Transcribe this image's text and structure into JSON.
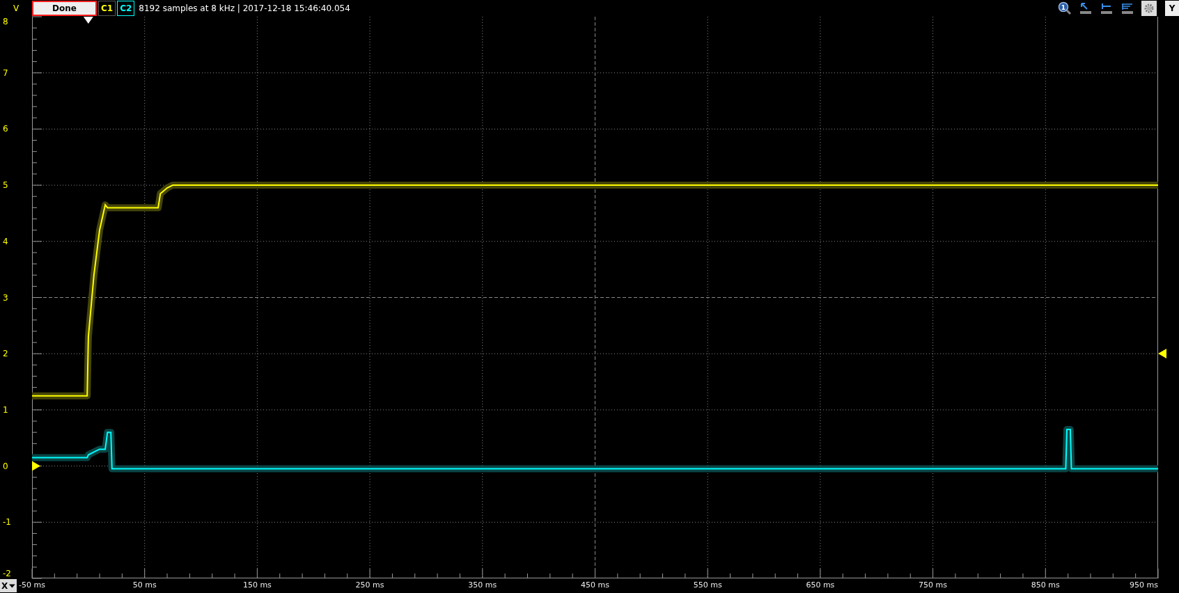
{
  "top_bar": {
    "axis_unit": "V",
    "status_button": "Done",
    "info": "8192 samples at 8 kHz | 2017-12-18 15:46:40.054",
    "zoom_badge": "1",
    "y_button": "Y"
  },
  "x_button": "X",
  "plot": {
    "chart_data": {
      "type": "line",
      "x": [
        -50,
        -1,
        0,
        5,
        10,
        15,
        17,
        20,
        21,
        62,
        64,
        70,
        75,
        868,
        869,
        872,
        873,
        950
      ],
      "series": [
        {
          "name": "C1",
          "color": "#ffff00",
          "values": [
            1.25,
            1.25,
            2.3,
            3.4,
            4.2,
            4.65,
            4.6,
            4.6,
            4.6,
            4.6,
            4.85,
            4.95,
            5.0,
            5.0,
            5.0,
            5.0,
            5.0,
            5.0
          ]
        },
        {
          "name": "C2",
          "color": "#00ffff",
          "values": [
            0.15,
            0.15,
            0.2,
            0.25,
            0.3,
            0.3,
            0.6,
            0.6,
            -0.05,
            -0.05,
            -0.05,
            -0.05,
            -0.05,
            -0.05,
            0.65,
            0.65,
            -0.05,
            -0.05
          ]
        }
      ],
      "grid": true,
      "xlim": [
        -50,
        950
      ],
      "ylim": [
        -2,
        8
      ],
      "xticks": [
        {
          "value": -50,
          "label": "-50 ms"
        },
        {
          "value": 50,
          "label": "50 ms"
        },
        {
          "value": 150,
          "label": "150 ms"
        },
        {
          "value": 250,
          "label": "250 ms"
        },
        {
          "value": 350,
          "label": "350 ms"
        },
        {
          "value": 450,
          "label": "450 ms"
        },
        {
          "value": 550,
          "label": "550 ms"
        },
        {
          "value": 650,
          "label": "650 ms"
        },
        {
          "value": 750,
          "label": "750 ms"
        },
        {
          "value": 850,
          "label": "850 ms"
        },
        {
          "value": 950,
          "label": "950 ms"
        }
      ],
      "yticks": [
        8,
        7,
        6,
        5,
        4,
        3,
        2,
        1,
        0,
        -1,
        -2
      ]
    }
  }
}
